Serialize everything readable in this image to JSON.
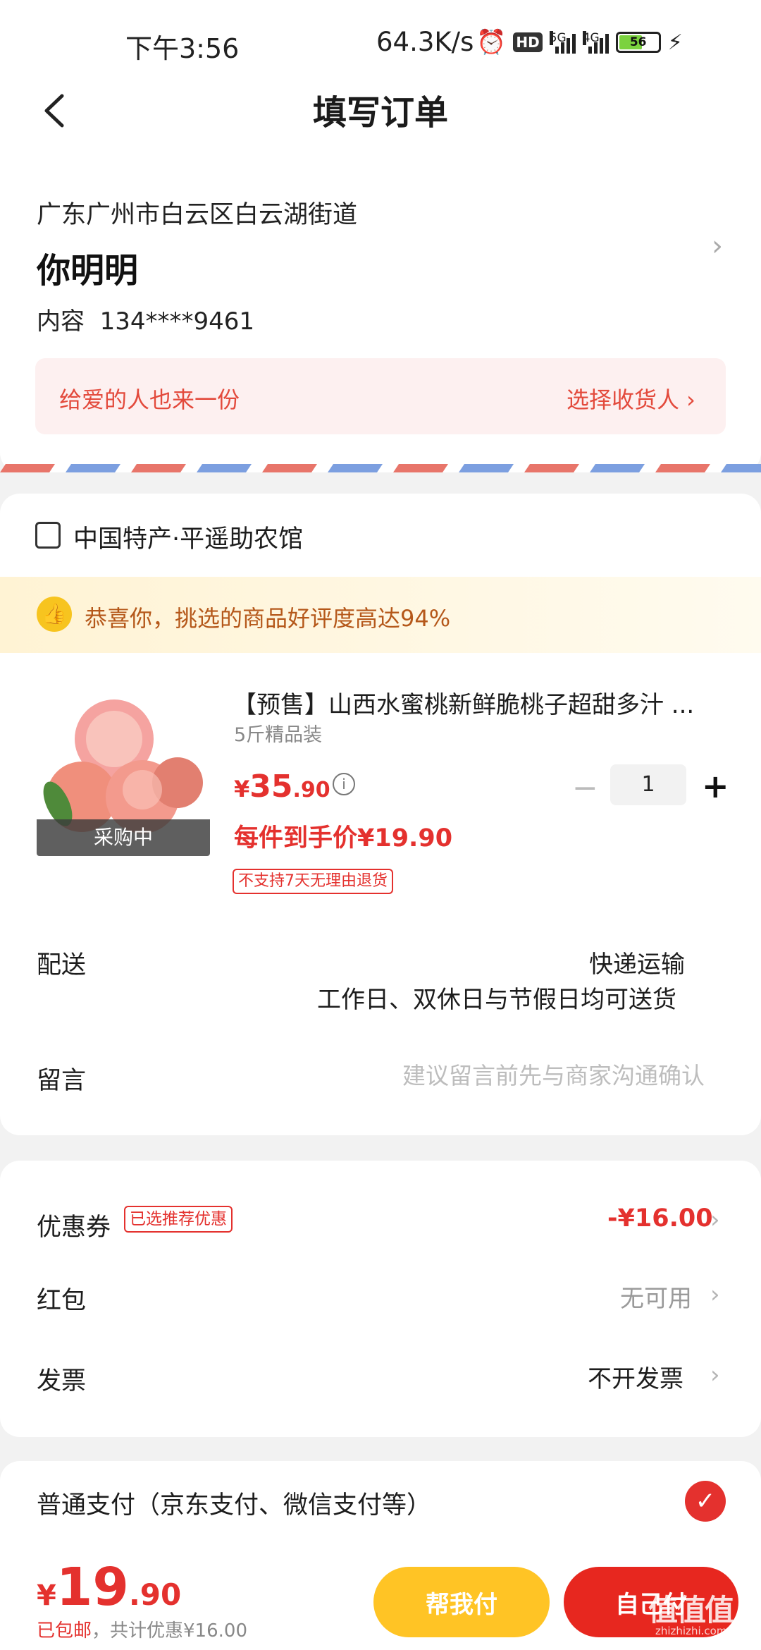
{
  "status_bar": {
    "time": "下午3:56",
    "net_speed": "64.3K/s",
    "hd": "HD",
    "net1": "5G",
    "net2": "4G",
    "battery": "56"
  },
  "header": {
    "title": "填写订单"
  },
  "address": {
    "region": "广东广州市白云区白云湖街道",
    "name": "你明明",
    "contact_label": "内容",
    "phone": "134****9461",
    "gift_text": "给爱的人也来一份",
    "gift_action": "选择收货人 ›"
  },
  "store": {
    "name": "中国特产·平遥助农馆",
    "praise": "恭喜你，挑选的商品好评度高达94%"
  },
  "product": {
    "title": "【预售】山西水蜜桃新鲜脆桃子超甜多汁 ...",
    "spec": "5斤精品装",
    "price_currency": "¥",
    "price_int": "35",
    "price_dec": ".90",
    "badge": "采购中",
    "quantity": "1",
    "minus": "−",
    "plus": "+",
    "final_price": "每件到手价¥19.90",
    "no_return": "不支持7天无理由退货"
  },
  "delivery": {
    "label": "配送",
    "method": "快递运输",
    "schedule": "工作日、双休日与节假日均可送货"
  },
  "message": {
    "label": "留言",
    "placeholder": "建议留言前先与商家沟通确认",
    "value": ""
  },
  "discounts": {
    "coupon_label": "优惠券",
    "coupon_tag": "已选推荐优惠",
    "coupon_value": "-¥16.00",
    "redpacket_label": "红包",
    "redpacket_value": "无可用",
    "invoice_label": "发票",
    "invoice_value": "不开发票"
  },
  "payment": {
    "label": "普通支付（京东支付、微信支付等）"
  },
  "footer": {
    "total_currency": "¥",
    "total_int": "19",
    "total_dec": ".90",
    "shipping": "已包邮",
    "saving": "，共计优惠¥16.00",
    "help_pay": "帮我付",
    "self_pay": "自己付",
    "watermark": "值值值",
    "watermark_sub": "zhizhizhi.com"
  },
  "colors": {
    "accent": "#e4312e",
    "gold": "#ffc425",
    "praise_text": "#b5581a"
  }
}
